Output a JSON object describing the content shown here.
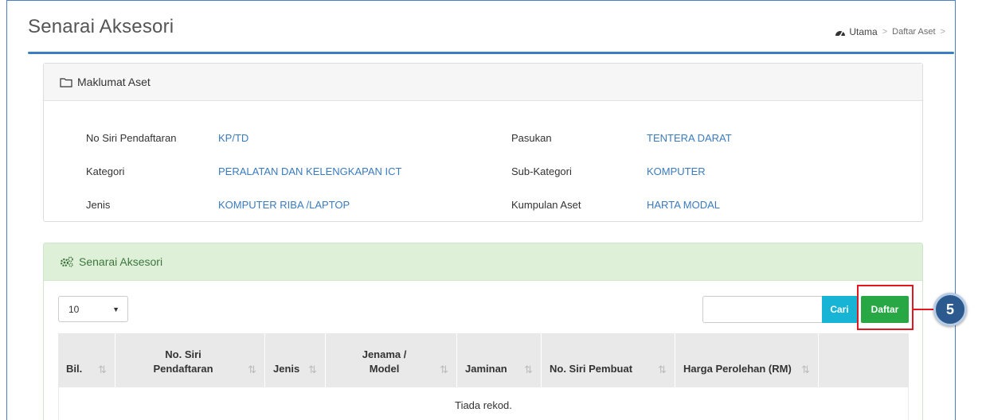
{
  "header": {
    "title": "Senarai Aksesori",
    "breadcrumb": {
      "home": "Utama",
      "sep1": ">",
      "item": "Daftar Aset",
      "sep2": ">"
    }
  },
  "info_panel": {
    "title": "Maklumat Aset",
    "rows": [
      {
        "label1": "No Siri Pendaftaran",
        "value1": "KP/TD",
        "label2": "Pasukan",
        "value2": "TENTERA DARAT"
      },
      {
        "label1": "Kategori",
        "value1": "PERALATAN DAN KELENGKAPAN ICT",
        "label2": "Sub-Kategori",
        "value2": "KOMPUTER"
      },
      {
        "label1": "Jenis",
        "value1": "KOMPUTER RIBA /LAPTOP",
        "label2": "Kumpulan Aset",
        "value2": "HARTA MODAL"
      }
    ]
  },
  "list_panel": {
    "title": "Senarai Aksesori",
    "page_length": "10",
    "search_value": "",
    "search_button": "Cari",
    "add_button": "Daftar",
    "columns": [
      {
        "l1": "",
        "l2": "Bil."
      },
      {
        "l1": "No. Siri",
        "l2": "Pendaftaran"
      },
      {
        "l1": "",
        "l2": "Jenis"
      },
      {
        "l1": "Jenama /",
        "l2": "Model"
      },
      {
        "l1": "",
        "l2": "Jaminan"
      },
      {
        "l1": "",
        "l2": "No. Siri Pembuat"
      },
      {
        "l1": "",
        "l2": "Harga Perolehan (RM)"
      }
    ],
    "empty_text": "Tiada rekod."
  },
  "callout": {
    "number": "5",
    "color": "#2d5a8e",
    "highlight_color": "#e3181f"
  },
  "colors": {
    "accent": "#3c7ec4",
    "link": "#3a7bbf",
    "success_bg": "#dff0d8",
    "info_btn": "#17b4d6",
    "success_btn": "#27a844"
  }
}
